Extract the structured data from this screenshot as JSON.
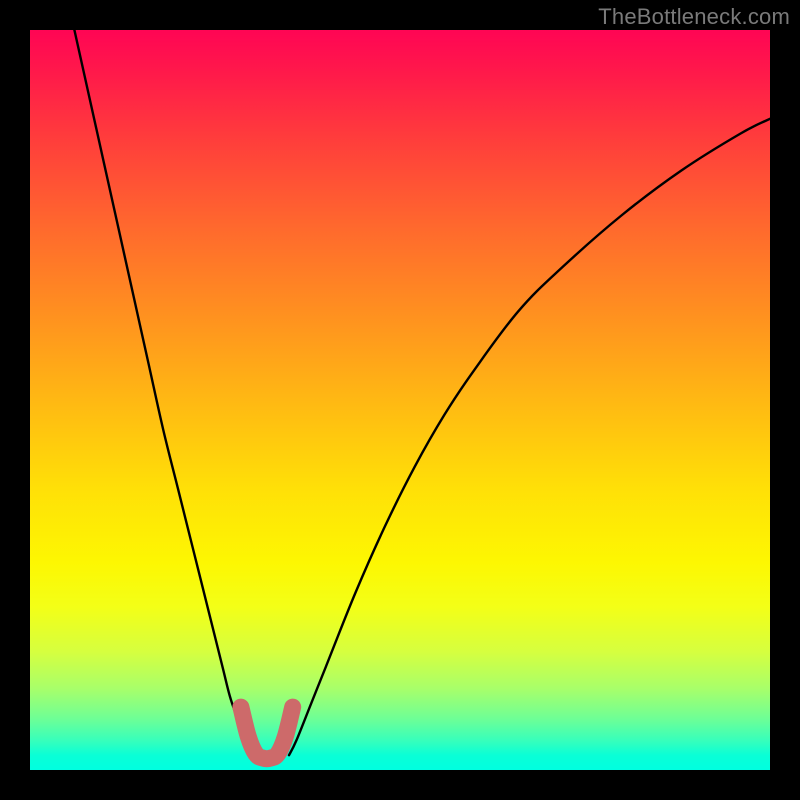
{
  "watermark": {
    "text": "TheBottleneck.com"
  },
  "colors": {
    "frame": "#000000",
    "curve": "#000000",
    "accent": "#cd6a6a",
    "watermark": "#7a7a7a"
  },
  "chart_data": {
    "type": "line",
    "title": "",
    "xlabel": "",
    "ylabel": "",
    "xlim": [
      0,
      100
    ],
    "ylim": [
      0,
      100
    ],
    "grid": false,
    "legend": false,
    "annotations": [],
    "series": [
      {
        "name": "left-branch",
        "x": [
          6,
          8,
          10,
          12,
          14,
          16,
          18,
          20,
          22,
          24,
          26,
          27,
          28,
          29,
          30
        ],
        "y": [
          100,
          91,
          82,
          73,
          64,
          55,
          46,
          38,
          30,
          22,
          14,
          10,
          7,
          4,
          2
        ]
      },
      {
        "name": "right-branch",
        "x": [
          35,
          36,
          38,
          40,
          44,
          48,
          52,
          56,
          60,
          66,
          72,
          80,
          88,
          96,
          100
        ],
        "y": [
          2,
          4,
          9,
          14,
          24,
          33,
          41,
          48,
          54,
          62,
          68,
          75,
          81,
          86,
          88
        ]
      },
      {
        "name": "valley-accent",
        "x": [
          28.5,
          29.5,
          30.5,
          31.5,
          32.5,
          33.5,
          34.5,
          35.5
        ],
        "y": [
          8.5,
          4.5,
          2.2,
          1.6,
          1.6,
          2.2,
          4.5,
          8.5
        ]
      }
    ]
  }
}
